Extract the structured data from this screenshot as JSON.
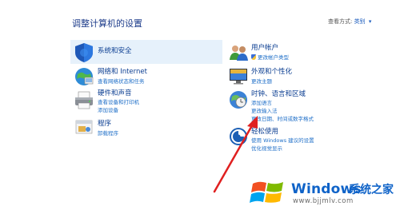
{
  "header": {
    "title": "调整计算机的设置",
    "view_by_label": "查看方式:",
    "view_by_value": "类别"
  },
  "left": [
    {
      "title": "系统和安全",
      "links": []
    },
    {
      "title": "网络和 Internet",
      "links": [
        "查看网络状态和任务"
      ]
    },
    {
      "title": "硬件和声音",
      "links": [
        "查看设备和打印机",
        "添加设备"
      ]
    },
    {
      "title": "程序",
      "links": [
        "卸载程序"
      ]
    }
  ],
  "right": [
    {
      "title": "用户帐户",
      "links": [
        "更改帐户类型"
      ]
    },
    {
      "title": "外观和个性化",
      "links": [
        "更改主题"
      ]
    },
    {
      "title": "时钟、语言和区域",
      "links": [
        "添加语言",
        "更改输入法",
        "更改日期、时间或数字格式"
      ]
    },
    {
      "title": "轻松使用",
      "links": [
        "使用 Windows 建议的设置",
        "优化视觉显示"
      ]
    }
  ],
  "watermark": {
    "brand": "Windows",
    "brand_cn": "系统之家",
    "url": "www.bjjmlv.com"
  },
  "colors": {
    "accent": "#0a3d91",
    "link": "#1f6fc8",
    "highlight": "#e6f1fb",
    "arrow": "#e02020"
  }
}
